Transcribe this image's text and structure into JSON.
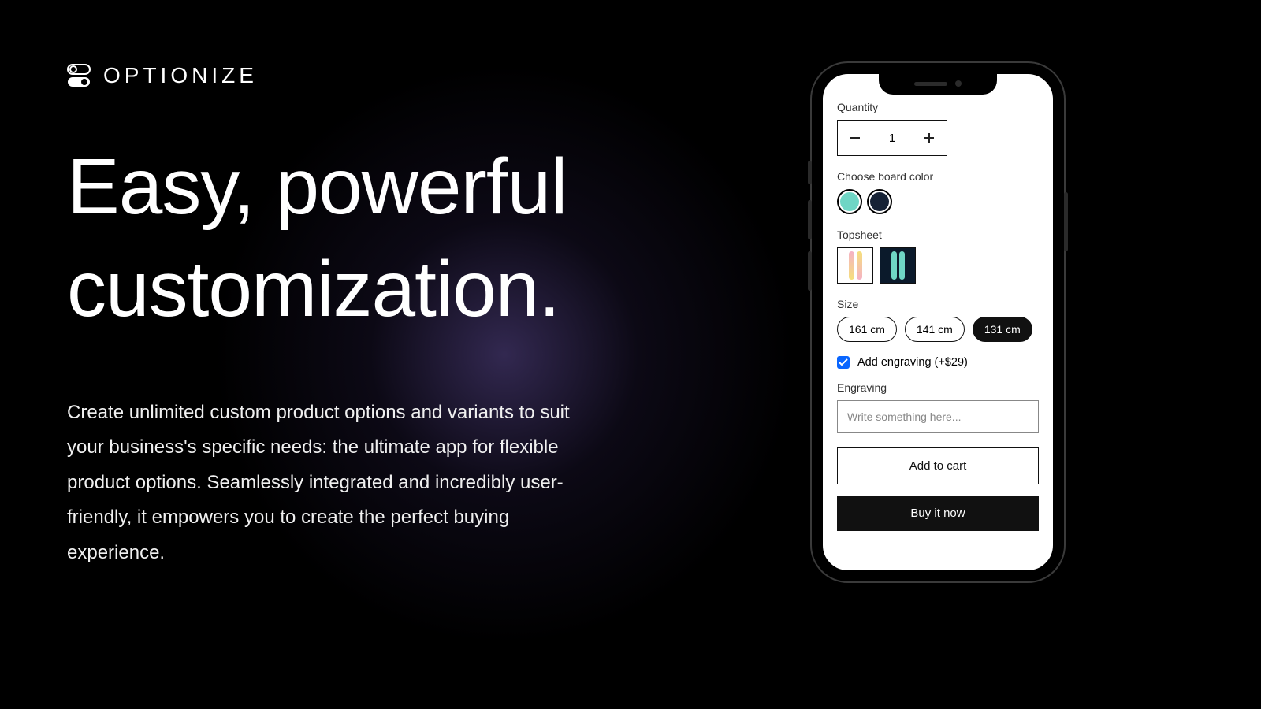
{
  "brand": {
    "name": "OPTIONIZE"
  },
  "hero": {
    "headline": "Easy, powerful customization.",
    "description": "Create unlimited custom product options and variants to suit your business's specific needs: the ultimate app for flexible product options. Seamlessly integrated and incredibly user-friendly, it empowers you to create the perfect buying experience."
  },
  "phone": {
    "quantity": {
      "label": "Quantity",
      "value": "1"
    },
    "board_color": {
      "label": "Choose board color",
      "options": [
        {
          "name": "teal",
          "hex": "#6fd6c5"
        },
        {
          "name": "navy",
          "hex": "#162235"
        }
      ]
    },
    "topsheet": {
      "label": "Topsheet",
      "options": [
        {
          "name": "gradient-light",
          "bg": "light",
          "boards": [
            "#f5b1c6",
            "#f5e07a"
          ]
        },
        {
          "name": "gradient-dark",
          "bg": "dark",
          "boards": [
            "#6fd6c5",
            "#6fd6c5"
          ]
        }
      ]
    },
    "size": {
      "label": "Size",
      "options": [
        "161 cm",
        "141 cm",
        "131 cm"
      ],
      "selected": "131 cm"
    },
    "engraving_check": {
      "label": "Add engraving (+$29)",
      "checked": true
    },
    "engraving": {
      "label": "Engraving",
      "placeholder": "Write something here..."
    },
    "buttons": {
      "add_to_cart": "Add to cart",
      "buy_now": "Buy it now"
    }
  }
}
